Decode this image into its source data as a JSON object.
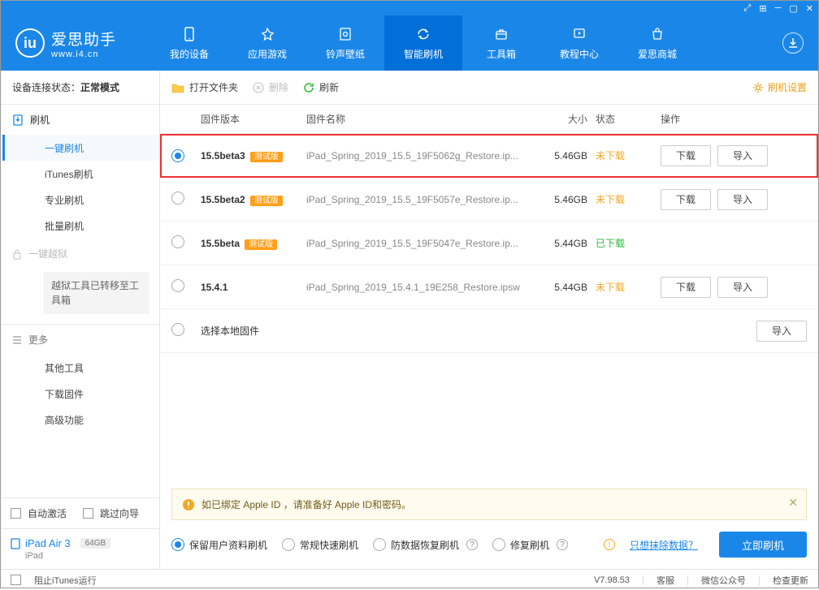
{
  "titlebar_icons": [
    "expand",
    "grid",
    "minimize",
    "maximize",
    "close"
  ],
  "logo": {
    "app_name": "爱思助手",
    "url": "www.i4.cn"
  },
  "nav": [
    {
      "id": "device",
      "label": "我的设备"
    },
    {
      "id": "apps",
      "label": "应用游戏"
    },
    {
      "id": "ring",
      "label": "铃声壁纸"
    },
    {
      "id": "flash",
      "label": "智能刷机"
    },
    {
      "id": "tools",
      "label": "工具箱"
    },
    {
      "id": "tutorial",
      "label": "教程中心"
    },
    {
      "id": "store",
      "label": "爱思商城"
    }
  ],
  "status": {
    "label": "设备连接状态：",
    "value": "正常模式"
  },
  "sidebar": {
    "flash_title": "刷机",
    "items": [
      {
        "id": "one",
        "label": "一键刷机",
        "active": true
      },
      {
        "id": "itunes",
        "label": "iTunes刷机"
      },
      {
        "id": "pro",
        "label": "专业刷机"
      },
      {
        "id": "batch",
        "label": "批量刷机"
      }
    ],
    "jailbreak": "一键越狱",
    "jailbreak_note": "越狱工具已转移至工具箱",
    "more": "更多",
    "more_items": [
      {
        "id": "other",
        "label": "其他工具"
      },
      {
        "id": "dlfw",
        "label": "下载固件"
      },
      {
        "id": "adv",
        "label": "高级功能"
      }
    ],
    "auto_activate": "自动激活",
    "skip_guide": "跳过向导",
    "device_name": "iPad Air 3",
    "device_storage": "64GB",
    "device_type": "iPad"
  },
  "toolbar": {
    "open": "打开文件夹",
    "delete": "删除",
    "refresh": "刷新",
    "settings": "刷机设置"
  },
  "columns": {
    "version": "固件版本",
    "name": "固件名称",
    "size": "大小",
    "status": "状态",
    "action": "操作"
  },
  "firmware": [
    {
      "selected": true,
      "highlight": true,
      "version": "15.5beta3",
      "beta": "测试版",
      "name": "iPad_Spring_2019_15.5_19F5062g_Restore.ip...",
      "size": "5.46GB",
      "status": "未下载",
      "status_cls": "notdl",
      "download": true,
      "import": true
    },
    {
      "selected": false,
      "version": "15.5beta2",
      "beta": "测试版",
      "name": "iPad_Spring_2019_15.5_19F5057e_Restore.ip...",
      "size": "5.46GB",
      "status": "未下载",
      "status_cls": "notdl",
      "download": true,
      "import": true
    },
    {
      "selected": false,
      "version": "15.5beta",
      "beta": "测试版",
      "name": "iPad_Spring_2019_15.5_19F5047e_Restore.ip...",
      "size": "5.44GB",
      "status": "已下载",
      "status_cls": "dl",
      "download": false,
      "import": false
    },
    {
      "selected": false,
      "version": "15.4.1",
      "beta": null,
      "name": "iPad_Spring_2019_15.4.1_19E258_Restore.ipsw",
      "size": "5.44GB",
      "status": "未下载",
      "status_cls": "notdl",
      "download": true,
      "import": true
    },
    {
      "selected": false,
      "version": "选择本地固件",
      "beta": null,
      "name": "",
      "size": "",
      "status": "",
      "status_cls": "",
      "download": false,
      "import": true,
      "local": true
    }
  ],
  "buttons": {
    "download": "下载",
    "import": "导入"
  },
  "notice": "如已绑定 Apple ID ，请准备好 Apple ID和密码。",
  "options": [
    {
      "id": "keep",
      "label": "保留用户资料刷机",
      "selected": true,
      "help": false
    },
    {
      "id": "normal",
      "label": "常规快速刷机",
      "selected": false,
      "help": false
    },
    {
      "id": "recover",
      "label": "防数据恢复刷机",
      "selected": false,
      "help": true
    },
    {
      "id": "repair",
      "label": "修复刷机",
      "selected": false,
      "help": true
    }
  ],
  "erase_link": "只想抹除数据？",
  "flash_button": "立即刷机",
  "footer": {
    "stop_itunes": "阻止iTunes运行",
    "version": "V7.98.53",
    "kefu": "客服",
    "wechat": "微信公众号",
    "update": "检查更新"
  }
}
